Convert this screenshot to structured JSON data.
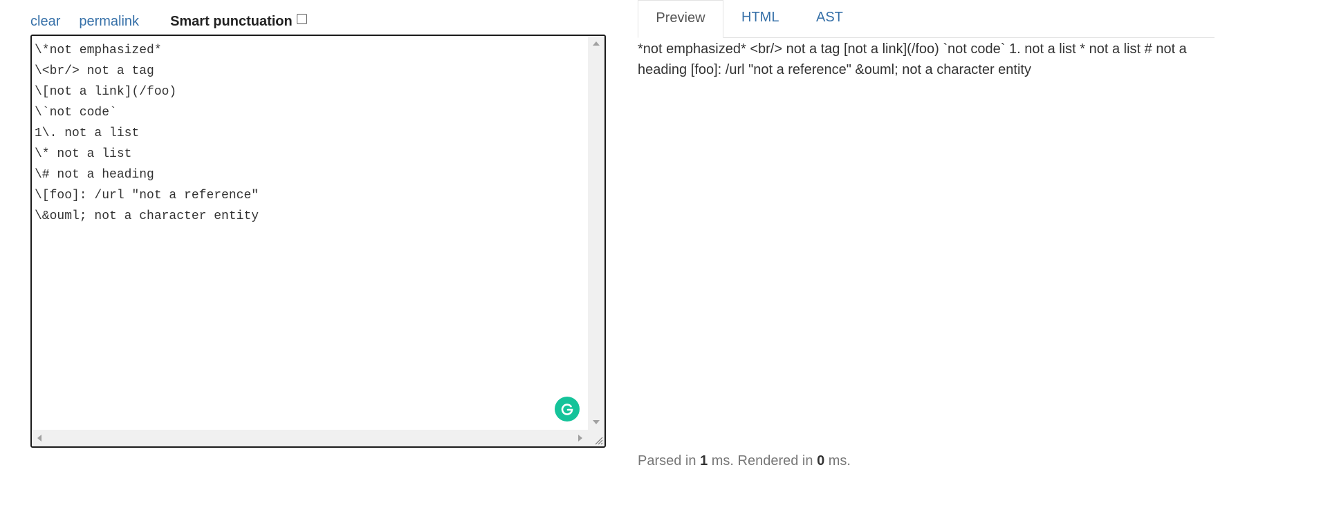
{
  "toolbar": {
    "clear_label": "clear",
    "permalink_label": "permalink",
    "smart_punctuation_label": "Smart punctuation",
    "smart_punctuation_checked": false
  },
  "editor": {
    "lines": [
      "\\*not emphasized*",
      "\\<br/> not a tag",
      "\\[not a link](/foo)",
      "\\`not code`",
      "1\\. not a list",
      "\\* not a list",
      "\\# not a heading",
      "\\[foo]: /url \"not a reference\"",
      "\\&ouml; not a character entity"
    ]
  },
  "tabs": [
    {
      "label": "Preview",
      "active": true
    },
    {
      "label": "HTML",
      "active": false
    },
    {
      "label": "AST",
      "active": false
    }
  ],
  "preview": {
    "text": "*not emphasized* <br/> not a tag [not a link](/foo) `not code` 1. not a list * not a list # not a heading [foo]: /url \"not a reference\" &ouml; not a character entity"
  },
  "stats": {
    "parsed_prefix": "Parsed in",
    "parsed_ms": "1",
    "rendered_prefix": "ms. Rendered in",
    "rendered_ms": "0",
    "suffix": "ms."
  },
  "colors": {
    "link": "#3670a8",
    "grammarly": "#15c39a",
    "stats": "#777777"
  },
  "icons": {
    "grammarly": "grammarly-icon",
    "resize": "resize-grip-icon"
  }
}
